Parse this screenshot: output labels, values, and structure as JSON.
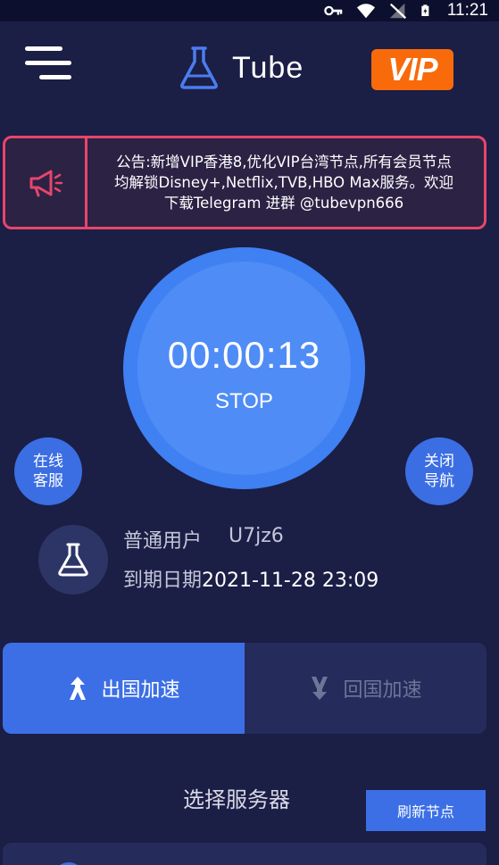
{
  "status_bar": {
    "time": "11:21",
    "icons": [
      "key-icon",
      "wifi-icon",
      "no-signal-icon",
      "battery-charging-icon"
    ]
  },
  "header": {
    "title": "Tube",
    "vip_label": "VIP",
    "menu_icon": "menu-icon",
    "logo_icon": "flask-icon"
  },
  "notice": {
    "icon": "megaphone-icon",
    "text": "公告:新增VIP香港8,优化VIP台湾节点,所有会员节点均解锁Disney+,Netflix,TVB,HBO Max服务。欢迎下载Telegram 进群 @tubevpn666"
  },
  "timer": {
    "elapsed": "00:00:13",
    "action_label": "STOP"
  },
  "side_buttons": {
    "support_label": "在线客服",
    "close_nav_label": "关闭导航"
  },
  "user": {
    "type_label": "普通用户",
    "user_id": "U7jz6",
    "expiry_label": "到期日期",
    "expiry_date": "2021-11-28 23:09"
  },
  "modes": {
    "outbound_label": "出国加速",
    "inbound_label": "回国加速",
    "active": "outbound"
  },
  "servers": {
    "section_title": "选择服务器",
    "refresh_label": "刷新节点"
  },
  "colors": {
    "background": "#1b1e45",
    "accent_blue": "#3c6fe6",
    "vip_orange": "#f96a0b",
    "notice_border": "#e8456b"
  }
}
